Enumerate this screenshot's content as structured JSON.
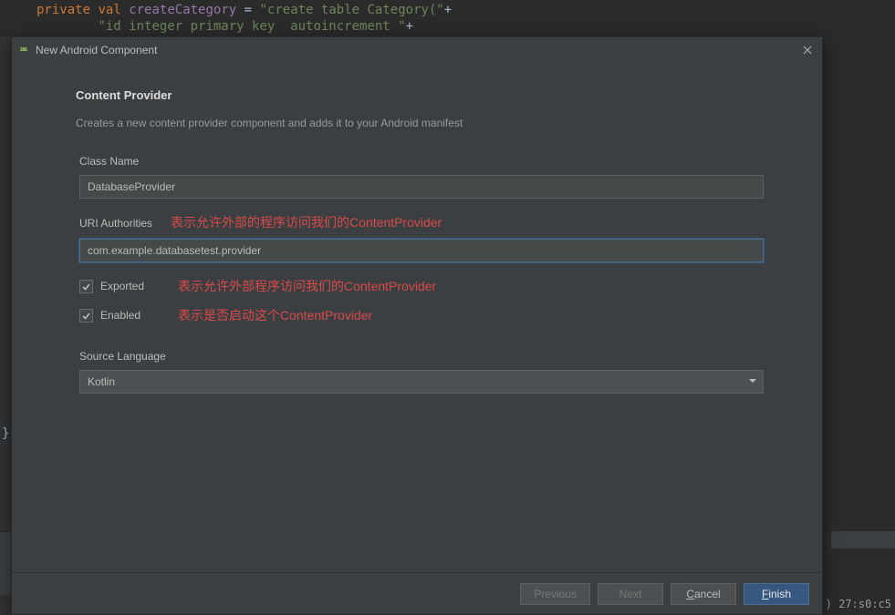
{
  "editor": {
    "line1_kw1": "private",
    "line1_kw2": "val",
    "line1_field": "createCategory",
    "line1_eq": " = ",
    "line1_str": "\"create table Category(\"",
    "line1_plus": "+",
    "line2_str": "\"id integer primary key  autoincrement \"",
    "line2_plus": "+",
    "brace": "}"
  },
  "dialog": {
    "title": "New Android Component",
    "heading": "Content Provider",
    "description": "Creates a new content provider component and adds it to your Android manifest",
    "class_name_label": "Class Name",
    "class_name_value": "DatabaseProvider",
    "uri_label": "URI Authorities",
    "uri_annot": "表示允许外部的程序访问我们的ContentProvider",
    "uri_value": "com.example.databasetest.provider",
    "exported_label": "Exported",
    "exported_annot": "表示允许外部程序访问我们的ContentProvider",
    "enabled_label": "Enabled",
    "enabled_annot": "表示是否启动这个ContentProvider",
    "source_lang_label": "Source Language",
    "source_lang_value": "Kotlin"
  },
  "buttons": {
    "previous": "Previous",
    "next": "Next",
    "cancel_u": "C",
    "cancel_rest": "ancel",
    "finish_u": "F",
    "finish_rest": "inish"
  },
  "status": {
    "right": ") 27:s0:c5"
  }
}
